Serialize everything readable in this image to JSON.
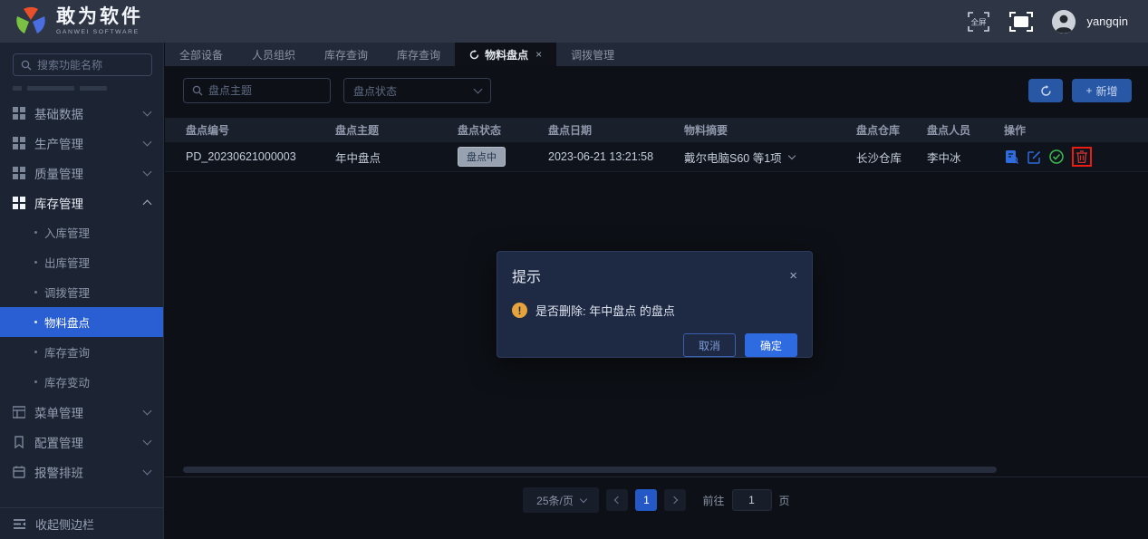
{
  "header": {
    "brand": "敢为软件",
    "brand_sub": "GANWEI  SOFTWARE",
    "fullscreen_label": "全屏",
    "username": "yangqin"
  },
  "tabs": [
    {
      "label": "全部设备",
      "active": false
    },
    {
      "label": "人员组织",
      "active": false
    },
    {
      "label": "库存查询",
      "active": false
    },
    {
      "label": "库存查询",
      "active": false
    },
    {
      "label": "物料盘点",
      "active": true
    },
    {
      "label": "调拨管理",
      "active": false
    }
  ],
  "sidebar": {
    "search_placeholder": "搜索功能名称",
    "groups_top": [
      {
        "label": "基础数据"
      },
      {
        "label": "生产管理"
      },
      {
        "label": "质量管理"
      },
      {
        "label": "库存管理",
        "expanded": true
      }
    ],
    "sub_items": [
      {
        "label": "入库管理"
      },
      {
        "label": "出库管理"
      },
      {
        "label": "调拨管理"
      },
      {
        "label": "物料盘点",
        "active": true
      },
      {
        "label": "库存查询"
      },
      {
        "label": "库存变动"
      }
    ],
    "groups_bottom": [
      {
        "label": "菜单管理"
      },
      {
        "label": "配置管理"
      },
      {
        "label": "报警排班"
      }
    ],
    "collapse_label": "收起侧边栏"
  },
  "filters": {
    "keyword_placeholder": "盘点主题",
    "status_placeholder": "盘点状态"
  },
  "toolbar": {
    "add_label": "新增",
    "plus_sign": "+"
  },
  "table": {
    "columns": [
      "盘点编号",
      "盘点主题",
      "盘点状态",
      "盘点日期",
      "物料摘要",
      "盘点仓库",
      "盘点人员",
      "操作"
    ],
    "row": {
      "code": "PD_20230621000003",
      "subject": "年中盘点",
      "status": "盘点中",
      "date": "2023-06-21 13:21:58",
      "summary": "戴尔电脑S60 等1项",
      "warehouse": "长沙仓库",
      "person": "李中冰"
    }
  },
  "pagination": {
    "page_size": "25条/页",
    "current_page": "1",
    "goto_label": "前往",
    "goto_value": "1",
    "page_unit": "页"
  },
  "dialog": {
    "title": "提示",
    "message": "是否删除: 年中盘点 的盘点",
    "warning_glyph": "!",
    "close_glyph": "×",
    "cancel_label": "取消",
    "confirm_label": "确定"
  },
  "colors": {
    "accent_blue": "#2a5fd4",
    "button_blue": "#2857a6",
    "confirm_blue": "#2e6be0",
    "warning_orange": "#e6a23c",
    "success_green": "#3fb950",
    "danger_red": "#c9302c",
    "highlight_red": "#ec1c12",
    "header_bg": "#2e3544",
    "sidebar_bg": "#1c2332",
    "content_bg": "#0d1016",
    "dialog_bg": "#1e2944"
  }
}
